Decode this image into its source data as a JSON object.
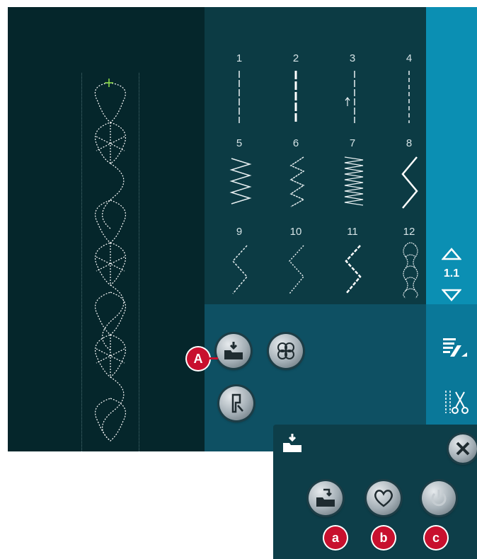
{
  "stitches": [
    {
      "number": "1"
    },
    {
      "number": "2"
    },
    {
      "number": "3"
    },
    {
      "number": "4"
    },
    {
      "number": "5"
    },
    {
      "number": "6"
    },
    {
      "number": "7"
    },
    {
      "number": "8"
    },
    {
      "number": "9"
    },
    {
      "number": "10"
    },
    {
      "number": "11"
    },
    {
      "number": "12"
    }
  ],
  "pager": {
    "page_label": "1.1"
  },
  "callouts": {
    "main": "A",
    "load": "a",
    "favorites": "b",
    "power": "c"
  },
  "colors": {
    "left_panel": "#05262b",
    "menu_area": "#0c3b44",
    "sidebar": "#0b8fb3",
    "callout": "#c8102e",
    "cursor": "#8ee04a"
  },
  "icons": {
    "load": "load-folder-icon",
    "flower": "flower-stitch-icon",
    "presser_foot": "presser-foot-icon",
    "favorites": "heart-icon",
    "power": "power-icon",
    "close": "close-icon",
    "popup_header": "load-folder-icon",
    "stitch_menu": "stitch-menu-icon",
    "scissors": "scissors-icon"
  }
}
